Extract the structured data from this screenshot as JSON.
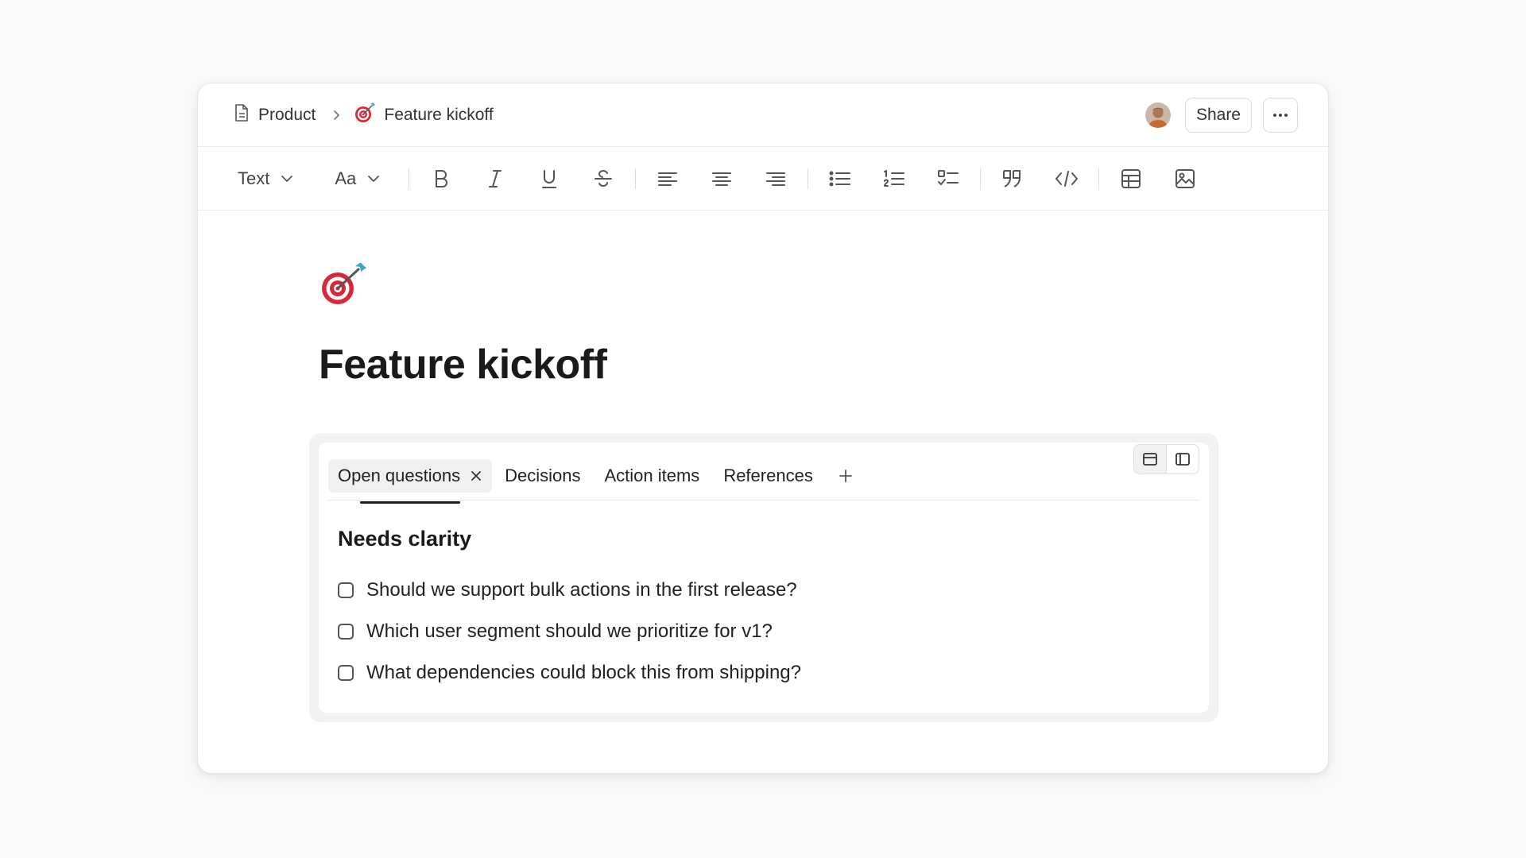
{
  "breadcrumb": {
    "parent": "Product",
    "current": "Feature kickoff",
    "current_emoji": "target-emoji"
  },
  "header": {
    "share_label": "Share",
    "avatar": "user-avatar"
  },
  "toolbar": {
    "block_type": "Text",
    "font_style": "Aa",
    "tools": [
      "bold",
      "italic",
      "underline",
      "strikethrough",
      "align-left",
      "align-center",
      "align-right",
      "bullet-list",
      "numbered-list",
      "checklist",
      "quote",
      "code",
      "table",
      "image"
    ]
  },
  "page": {
    "emoji": "target-emoji",
    "title": "Feature kickoff"
  },
  "tabs": {
    "items": [
      {
        "label": "Open questions",
        "active": true
      },
      {
        "label": "Decisions",
        "active": false
      },
      {
        "label": "Action items",
        "active": false
      },
      {
        "label": "References",
        "active": false
      }
    ],
    "panel": {
      "heading": "Needs clarity",
      "questions": [
        {
          "text": "Should we support bulk actions in the first release?",
          "checked": false
        },
        {
          "text": "Which user segment should we prioritize for v1?",
          "checked": false
        },
        {
          "text": "What dependencies could block this from shipping?",
          "checked": false
        }
      ]
    }
  },
  "colors": {
    "background": "#f9f9f9",
    "card": "#ffffff",
    "border": "#e6e6e6",
    "text": "#1f1f1f",
    "target_red": "#d8283a"
  }
}
